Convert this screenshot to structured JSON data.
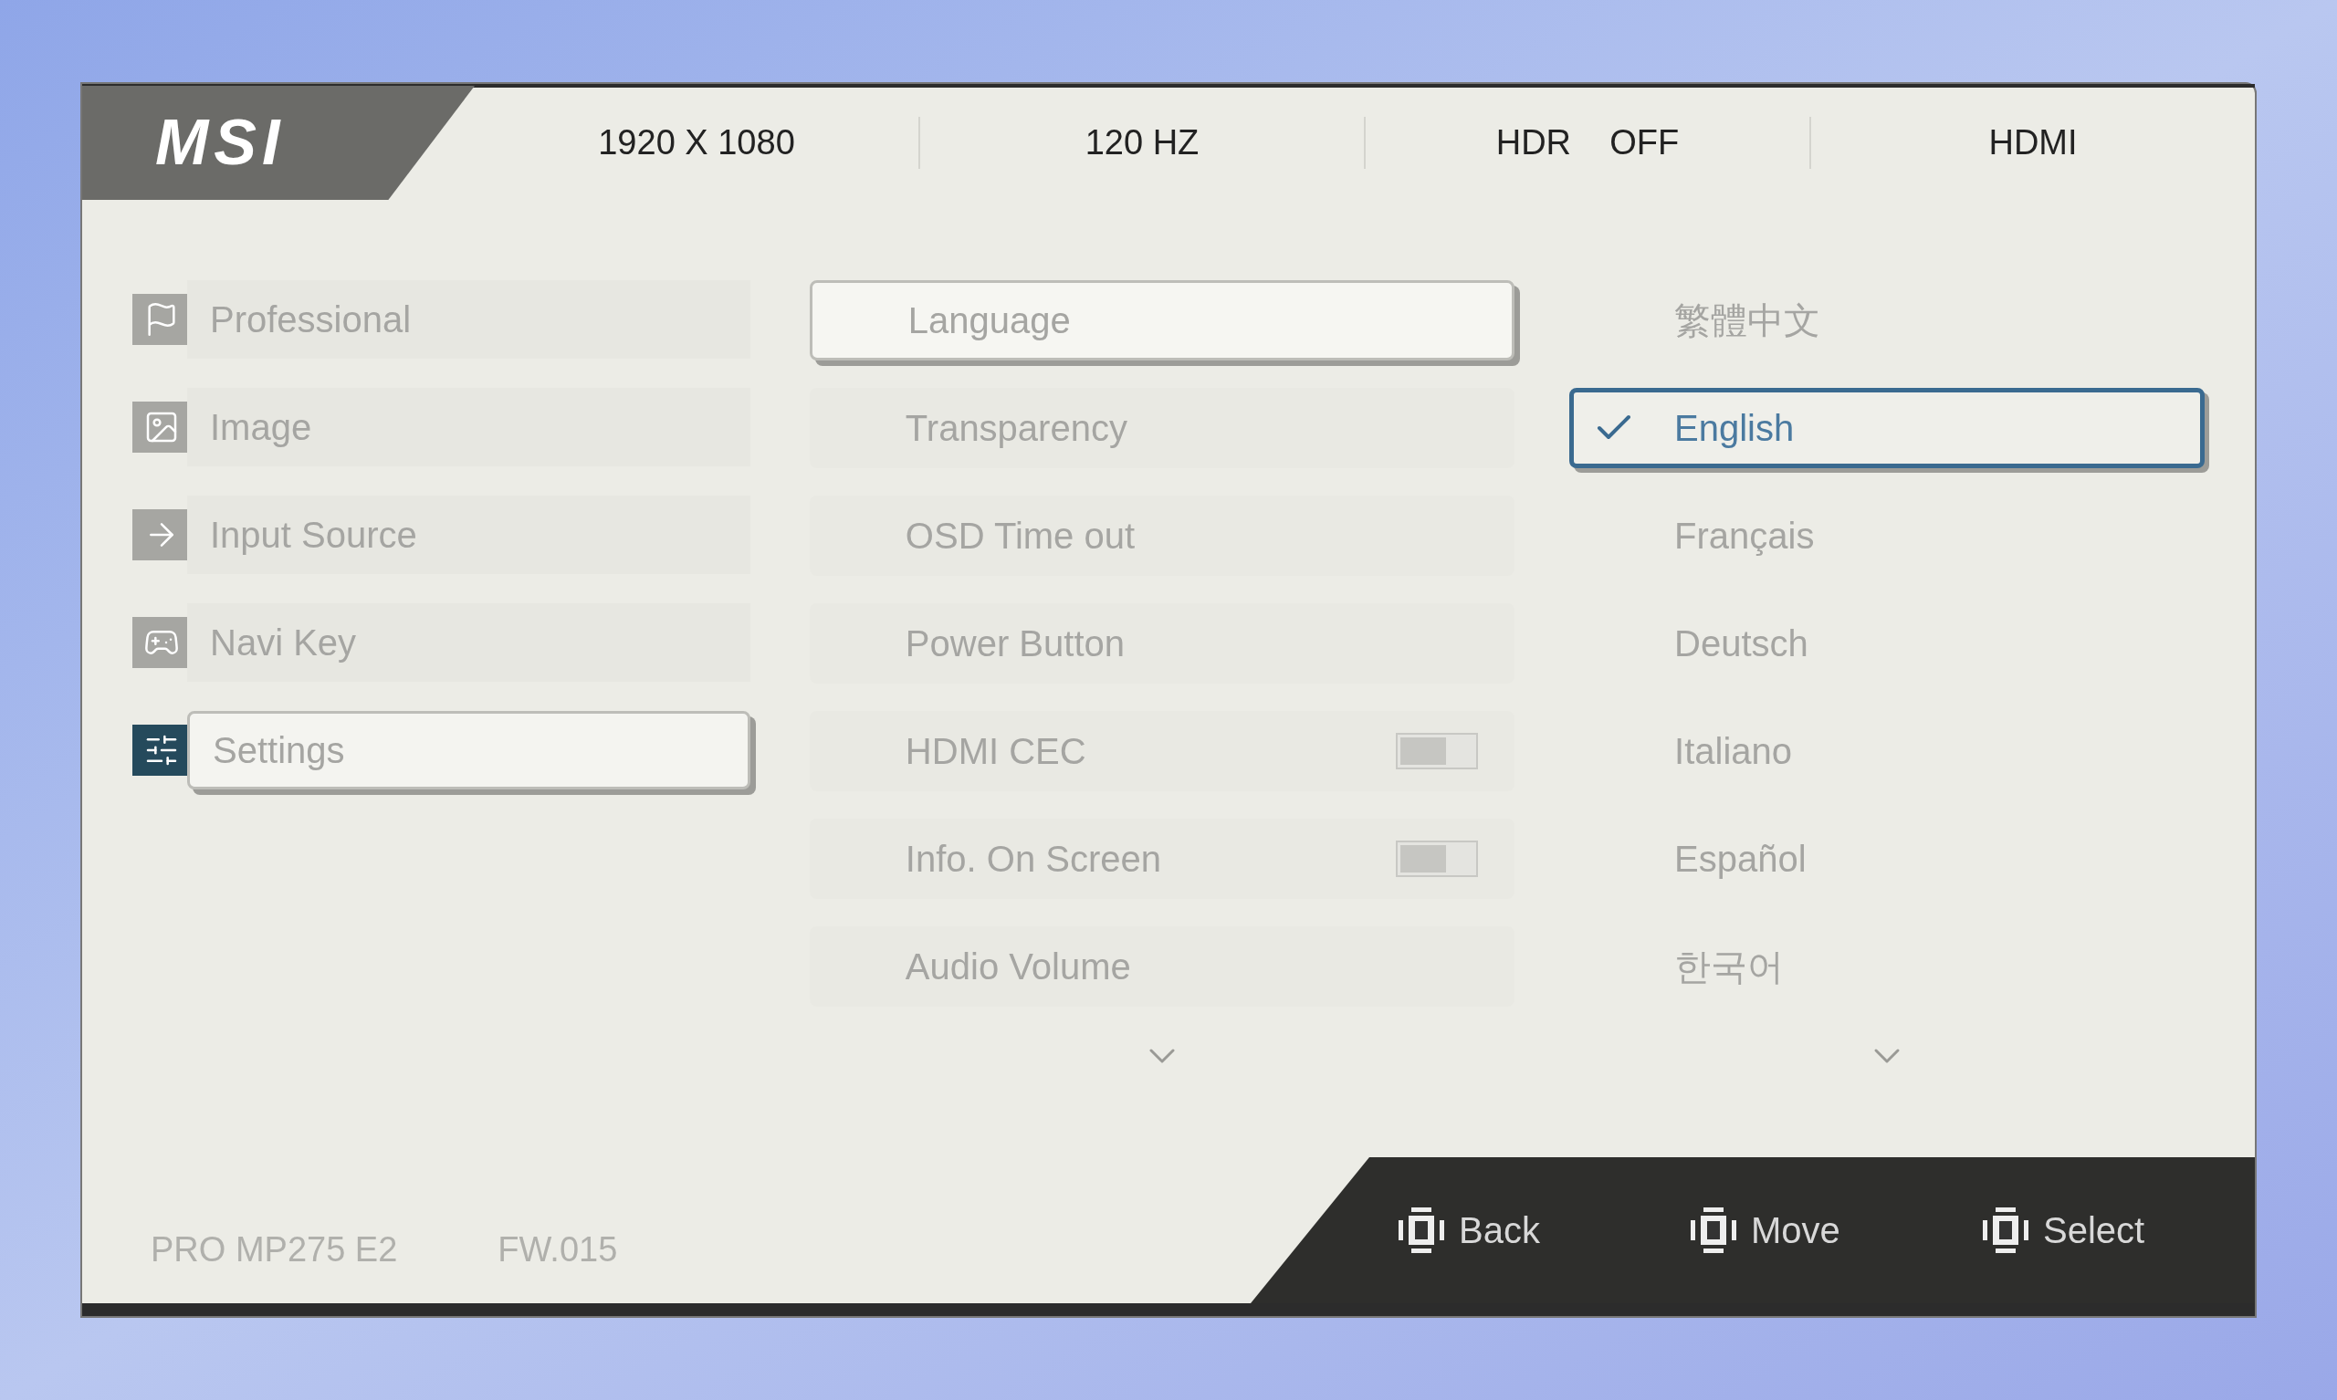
{
  "logo": "MSI",
  "status": [
    "1920 X 1080",
    "120 HZ",
    "HDR    OFF",
    "HDMI"
  ],
  "menu": [
    {
      "label": "Professional",
      "selected": false
    },
    {
      "label": "Image",
      "selected": false
    },
    {
      "label": "Input Source",
      "selected": false
    },
    {
      "label": "Navi Key",
      "selected": false
    },
    {
      "label": "Settings",
      "selected": true
    }
  ],
  "settings": [
    {
      "label": "Language",
      "kind": "plain",
      "selected": true
    },
    {
      "label": "Transparency",
      "kind": "plain",
      "selected": false
    },
    {
      "label": "OSD Time out",
      "kind": "plain",
      "selected": false
    },
    {
      "label": "Power Button",
      "kind": "plain",
      "selected": false
    },
    {
      "label": "HDMI CEC",
      "kind": "toggle",
      "on": false,
      "selected": false
    },
    {
      "label": "Info. On Screen",
      "kind": "toggle",
      "on": false,
      "selected": false
    },
    {
      "label": "Audio Volume",
      "kind": "plain",
      "selected": false
    }
  ],
  "languages": [
    {
      "label": "繁體中文",
      "checked": false,
      "selected": false
    },
    {
      "label": "English",
      "checked": true,
      "selected": true
    },
    {
      "label": "Français",
      "checked": false,
      "selected": false
    },
    {
      "label": "Deutsch",
      "checked": false,
      "selected": false
    },
    {
      "label": "Italiano",
      "checked": false,
      "selected": false
    },
    {
      "label": "Español",
      "checked": false,
      "selected": false
    },
    {
      "label": "한국어",
      "checked": false,
      "selected": false
    }
  ],
  "footer": {
    "model": "PRO MP275 E2",
    "firmware": "FW.015"
  },
  "keys": [
    "Back",
    "Move",
    "Select"
  ]
}
